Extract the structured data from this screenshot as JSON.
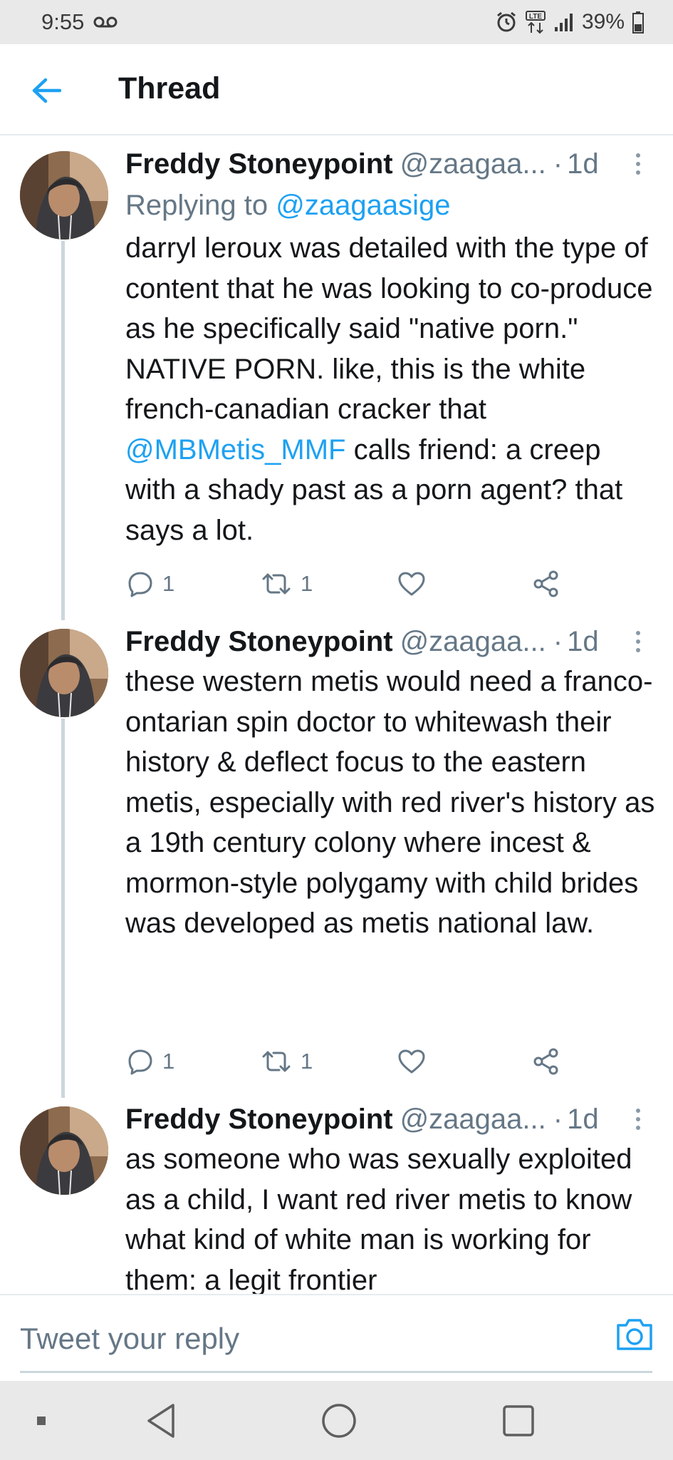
{
  "status_bar": {
    "time": "9:55",
    "battery": "39%",
    "icons": [
      "voicemail-icon",
      "alarm-icon",
      "lte-icon",
      "signal-icon",
      "battery-icon"
    ]
  },
  "header": {
    "title": "Thread",
    "back_icon": "arrow-left-icon"
  },
  "tweets": [
    {
      "author": "Freddy Stoneypoint",
      "handle": "@zaagaa...",
      "separator": "·",
      "time": "1d",
      "replying_to_label": "Replying to",
      "replying_to_handle": "@zaagaasige",
      "text_parts": [
        "darryl leroux was detailed with the type of content that he was looking to co-produce as he specifically said \"native porn.\" NATIVE PORN. like, this is the white french-canadian cracker that ",
        "@MBMetis_MMF",
        " calls friend: a creep with a shady past as a porn agent? that says a lot."
      ],
      "replies": "1",
      "retweets": "1"
    },
    {
      "author": "Freddy Stoneypoint",
      "handle": "@zaagaa...",
      "separator": "·",
      "time": "1d",
      "text": "these western metis would need a franco-ontarian spin doctor to whitewash their history & deflect focus to the eastern metis, especially with red river's history as a 19th century colony where incest & mormon-style polygamy with child brides was developed as metis national law.",
      "replies": "1",
      "retweets": "1"
    },
    {
      "author": "Freddy Stoneypoint",
      "handle": "@zaagaa...",
      "separator": "·",
      "time": "1d",
      "text": "as someone who was sexually exploited as a child, I want red river metis to know what kind of white man is working for them: a legit frontier"
    }
  ],
  "reply_bar": {
    "placeholder": "Tweet your reply",
    "camera_icon": "camera-icon"
  },
  "nav_bar": {
    "icons": [
      "recent-apps-dot-icon",
      "back-triangle-icon",
      "home-circle-icon",
      "overview-square-icon"
    ]
  },
  "colors": {
    "accent": "#1da1f2",
    "text": "#14171a",
    "secondary": "#657786",
    "divider": "#e6ecf0",
    "system_bar": "#e9e9ea"
  }
}
